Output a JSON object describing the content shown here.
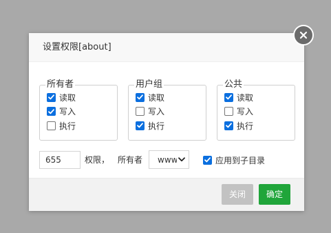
{
  "dialog": {
    "title": "设置权限[about]",
    "close_icon": "close-icon"
  },
  "groups": [
    {
      "legend": "所有者",
      "items": [
        {
          "label": "读取",
          "checked": true
        },
        {
          "label": "写入",
          "checked": true
        },
        {
          "label": "执行",
          "checked": false
        }
      ]
    },
    {
      "legend": "用户组",
      "items": [
        {
          "label": "读取",
          "checked": true
        },
        {
          "label": "写入",
          "checked": false
        },
        {
          "label": "执行",
          "checked": true
        }
      ]
    },
    {
      "legend": "公共",
      "items": [
        {
          "label": "读取",
          "checked": true
        },
        {
          "label": "写入",
          "checked": false
        },
        {
          "label": "执行",
          "checked": true
        }
      ]
    }
  ],
  "permission": {
    "value": "655",
    "label": "权限，",
    "owner_label": "所有者",
    "owner_value": "www"
  },
  "apply_subdirs": {
    "label": "应用到子目录",
    "checked": true
  },
  "footer": {
    "close_label": "关闭",
    "ok_label": "确定"
  },
  "colors": {
    "checkbox_on": "#0b6fdf",
    "ok_button": "#20a53a",
    "close_button": "#c2c2c2"
  }
}
